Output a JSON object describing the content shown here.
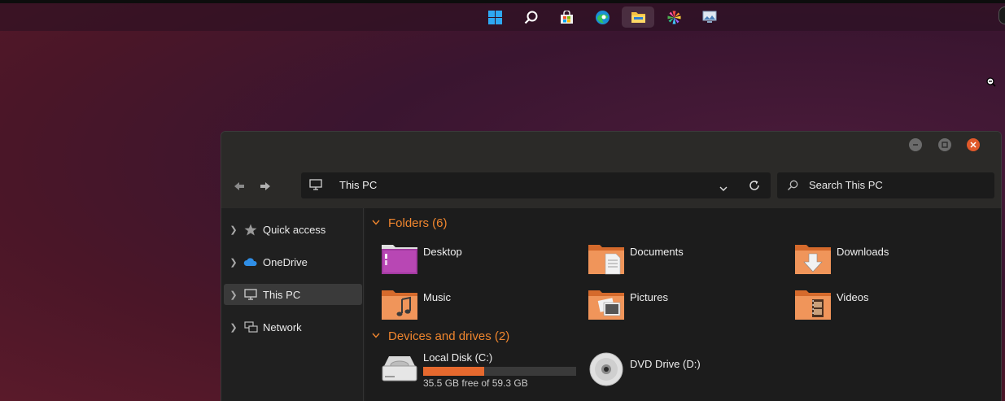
{
  "taskbar": {
    "icons": [
      "windows-start-icon",
      "search-icon",
      "store-icon",
      "edge-icon",
      "file-explorer-icon",
      "photos-pinwheel-icon",
      "photo-viewer-icon"
    ],
    "active": "file-explorer-icon"
  },
  "window": {
    "address": "This PC",
    "search_placeholder": "Search This PC",
    "sidebar": [
      {
        "label": "Quick access",
        "icon": "star-icon"
      },
      {
        "label": "OneDrive",
        "icon": "cloud-icon"
      },
      {
        "label": "This PC",
        "icon": "computer-icon",
        "selected": true
      },
      {
        "label": "Network",
        "icon": "network-icon"
      }
    ],
    "folders_header": "Folders (6)",
    "folders": [
      {
        "label": "Desktop",
        "icon": "desktop-folder-icon"
      },
      {
        "label": "Documents",
        "icon": "documents-folder-icon"
      },
      {
        "label": "Downloads",
        "icon": "downloads-folder-icon"
      },
      {
        "label": "Music",
        "icon": "music-folder-icon"
      },
      {
        "label": "Pictures",
        "icon": "pictures-folder-icon"
      },
      {
        "label": "Videos",
        "icon": "videos-folder-icon"
      }
    ],
    "drives_header": "Devices and drives (2)",
    "drives": [
      {
        "label": "Local Disk (C:)",
        "detail": "35.5 GB free of 59.3 GB",
        "used_fraction": 0.4,
        "icon": "hard-disk-icon"
      },
      {
        "label": "DVD Drive (D:)",
        "icon": "dvd-icon"
      }
    ]
  },
  "colors": {
    "accent": "#f0862e",
    "bar_fill": "#e6692e",
    "close": "#e0592a"
  }
}
